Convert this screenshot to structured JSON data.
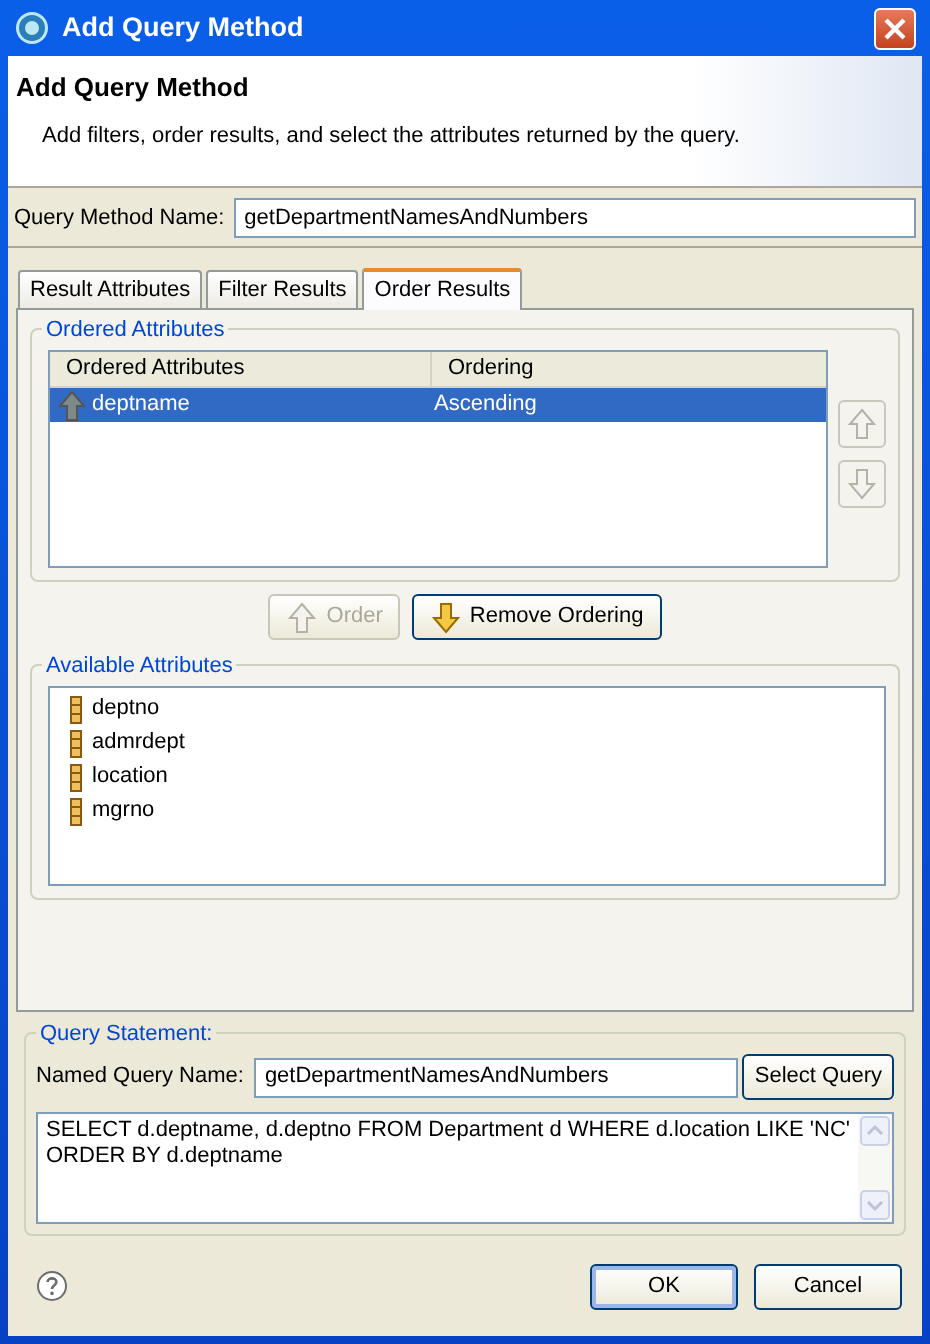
{
  "window": {
    "title": "Add Query Method"
  },
  "header": {
    "title": "Add Query Method",
    "description": "Add filters, order results, and select the attributes returned by the query."
  },
  "method_name": {
    "label": "Query Method Name:",
    "value": "getDepartmentNamesAndNumbers"
  },
  "tabs": [
    {
      "label": "Result Attributes",
      "selected": false
    },
    {
      "label": "Filter Results",
      "selected": false
    },
    {
      "label": "Order Results",
      "selected": true
    }
  ],
  "ordered_attributes": {
    "group_title": "Ordered Attributes",
    "columns": [
      "Ordered Attributes",
      "Ordering"
    ],
    "rows": [
      {
        "name": "deptname",
        "ordering": "Ascending",
        "selected": true
      }
    ],
    "move_up_disabled": true,
    "move_down_disabled": true
  },
  "order_buttons": [
    {
      "label": "Order",
      "kind": "up",
      "disabled": true
    },
    {
      "label": "Remove Ordering",
      "kind": "down",
      "disabled": false
    }
  ],
  "available_attributes": {
    "group_title": "Available Attributes",
    "items": [
      "deptno",
      "admrdept",
      "location",
      "mgrno"
    ]
  },
  "query_statement": {
    "group_title": "Query Statement:",
    "name_label": "Named Query Name:",
    "name_value": "getDepartmentNamesAndNumbers",
    "select_button": "Select Query",
    "lines": [
      "SELECT d.deptname, d.deptno FROM Department d WHERE d.location LIKE 'NC'",
      "ORDER BY d.deptname"
    ]
  },
  "footer_buttons": [
    {
      "label": "OK",
      "default": true
    },
    {
      "label": "Cancel",
      "default": false
    }
  ]
}
